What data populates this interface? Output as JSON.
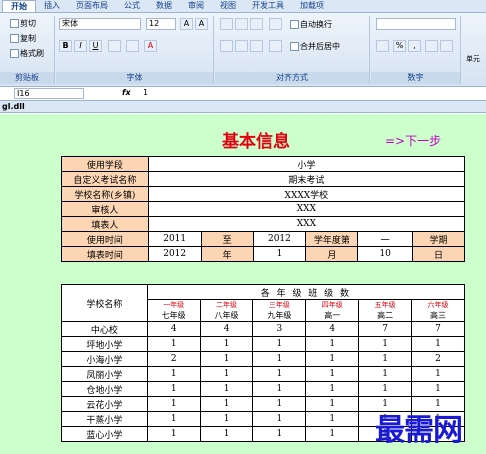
{
  "ribbon": {
    "tabs": [
      "开始",
      "插入",
      "页面布局",
      "公式",
      "数据",
      "审阅",
      "视图",
      "开发工具",
      "加载项"
    ],
    "clipboard": {
      "cut": "剪切",
      "copy": "复制",
      "format_painter": "格式刷",
      "label": "剪贴板"
    },
    "font": {
      "name": "宋体",
      "size": "12",
      "bold": "B",
      "italic": "I",
      "underline": "U",
      "label": "字体",
      "grow": "A",
      "shrink": "A",
      "color": "A"
    },
    "alignment": {
      "wrap": "自动换行",
      "merge": "合并后居中",
      "label": "对齐方式"
    },
    "number": {
      "label": "数字",
      "percent": "%",
      "comma": ","
    },
    "other": {
      "label": "单元"
    }
  },
  "formula_bar": {
    "cell_ref": "I16",
    "fx": "fx",
    "value": "1"
  },
  "workbook_tab": "gl.dll",
  "sheet": {
    "title": "基本信息",
    "next_link": "=>下一步",
    "info": [
      {
        "label": "使用学段",
        "value": "小学"
      },
      {
        "label": "自定义考试名称",
        "value": "期末考试"
      },
      {
        "label": "学校名称(乡镇)",
        "value": "XXXX学校"
      },
      {
        "label": "审核人",
        "value": "XXX"
      },
      {
        "label": "填表人",
        "value": "XXX"
      }
    ],
    "time_row1": [
      "使用时间",
      "2011",
      "至",
      "2012",
      "学年度第",
      "一",
      "学期"
    ],
    "time_row2": [
      "填表时间",
      "2012",
      "年",
      "1",
      "月",
      "10",
      "日"
    ],
    "classes": {
      "school_header": "学校名称",
      "group_header": "各 年 级 班 级 数",
      "grades": [
        {
          "top": "一年级",
          "bottom": "七年级"
        },
        {
          "top": "二年级",
          "bottom": "八年级"
        },
        {
          "top": "三年级",
          "bottom": "九年级"
        },
        {
          "top": "四年级",
          "bottom": "高一"
        },
        {
          "top": "五年级",
          "bottom": "高二"
        },
        {
          "top": "六年级",
          "bottom": "高三"
        }
      ],
      "rows": [
        {
          "name": "中心校",
          "counts": [
            "4",
            "4",
            "3",
            "4",
            "7",
            "7"
          ]
        },
        {
          "name": "坪地小学",
          "counts": [
            "1",
            "1",
            "1",
            "1",
            "1",
            "1"
          ]
        },
        {
          "name": "小海小学",
          "counts": [
            "2",
            "1",
            "1",
            "1",
            "1",
            "2"
          ]
        },
        {
          "name": "凤丽小学",
          "counts": [
            "1",
            "1",
            "1",
            "1",
            "1",
            "1"
          ]
        },
        {
          "name": "仓地小学",
          "counts": [
            "1",
            "1",
            "1",
            "1",
            "1",
            "1"
          ]
        },
        {
          "name": "云花小学",
          "counts": [
            "1",
            "1",
            "1",
            "1",
            "1",
            "1"
          ]
        },
        {
          "name": "干蒸小学",
          "counts": [
            "1",
            "1",
            "1",
            "1",
            "1",
            "1"
          ]
        },
        {
          "name": "蓝心小学",
          "counts": [
            "1",
            "1",
            "1",
            "1",
            "1",
            "1"
          ]
        }
      ]
    }
  },
  "watermark": "最需网"
}
